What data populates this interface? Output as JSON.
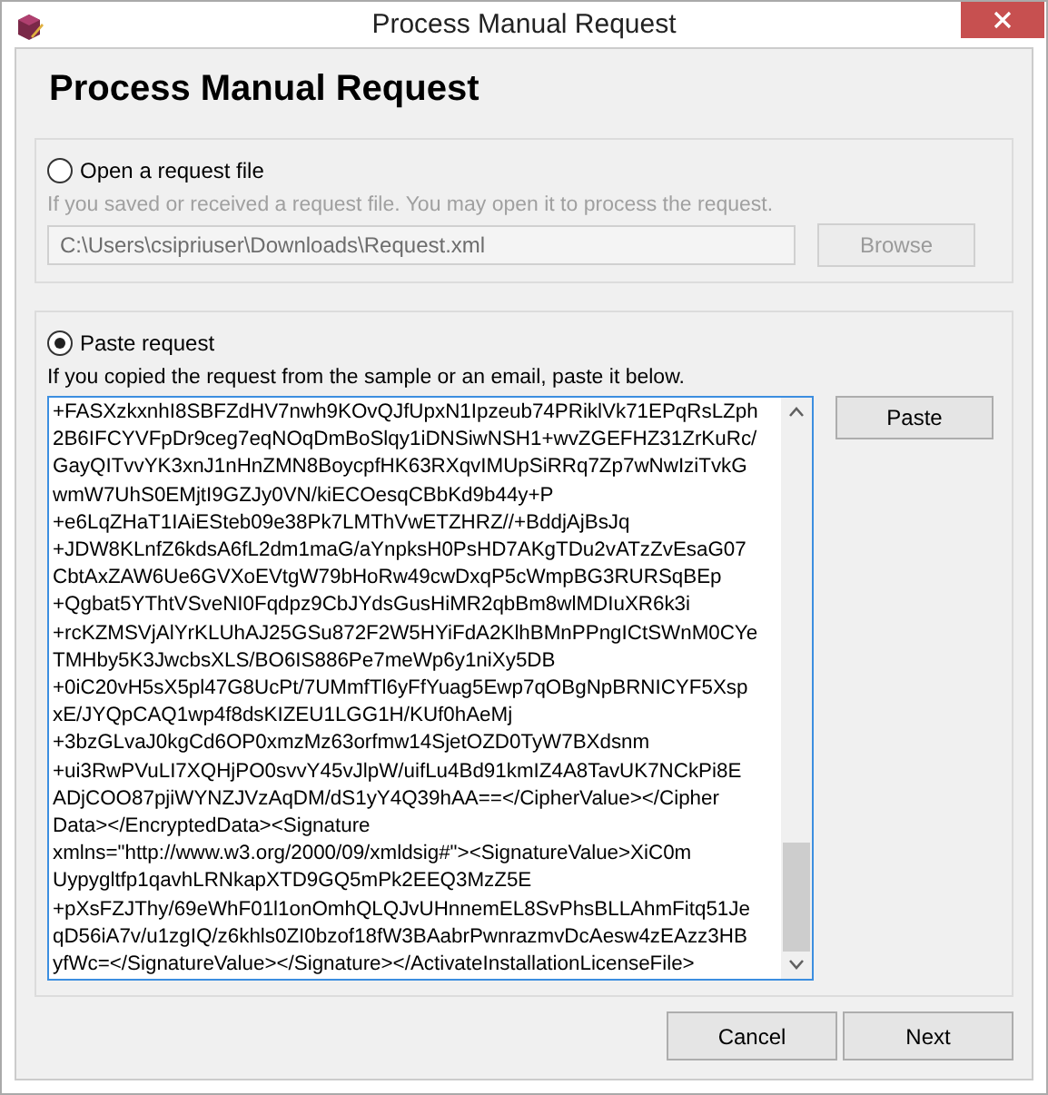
{
  "window": {
    "title": "Process Manual Request"
  },
  "heading": "Process Manual Request",
  "options": [
    {
      "label": "Open a request file",
      "selected": false,
      "disabled": true,
      "hint": "If you saved or received a request file. You may open it to process the request.",
      "path": "C:\\Users\\csipriuser\\Downloads\\Request.xml",
      "button": "Browse"
    },
    {
      "label": "Paste request",
      "selected": true,
      "disabled": false,
      "hint": "If you copied the request from the sample or an email, paste it below.",
      "button": "Paste",
      "lines": [
        "+FASXzkxnhI8SBFZdHV7nwh9KOvQJfUpxN1Ipzeub74PRiklVk71EPqRsLZph",
        "2B6IFCYVFpDr9ceg7eqNOqDmBoSlqy1iDNSiwNSH1+wvZGEFHZ31ZrKuRc/",
        "GayQITvvYK3xnJ1nHnZMN8BoycpfHK63RXqvIMUpSiRRq7Zp7wNwIziTvkG",
        "wmW7UhS0EMjtI9GZJy0VN/kiECOesqCBbKd9b44y+P",
        "+e6LqZHaT1IAiESteb09e38Pk7LMThVwETZHRZ//+BddjAjBsJq",
        "+JDW8KLnfZ6kdsA6fL2dm1maG/aYnpksH0PsHD7AKgTDu2vATzZvEsaG07",
        "CbtAxZAW6Ue6GVXoEVtgW79bHoRw49cwDxqP5cWmpBG3RURSqBEp",
        "+Qgbat5YThtVSveNI0Fqdpz9CbJYdsGusHiMR2qbBm8wlMDIuXR6k3i",
        "+rcKZMSVjAlYrKLUhAJ25GSu872F2W5HYiFdA2KlhBMnPPngICtSWnM0CYe",
        "TMHby5K3JwcbsXLS/BO6IS886Pe7meWp6y1niXy5DB",
        "+0iC20vH5sX5pl47G8UcPt/7UMmfTl6yFfYuag5Ewp7qOBgNpBRNICYF5Xsp",
        "xE/JYQpCAQ1wp4f8dsKIZEU1LGG1H/KUf0hAeMj",
        "+3bzGLvaJ0kgCd6OP0xmzMz63orfmw14SjetOZD0TyW7BXdsnm",
        "+ui3RwPVuLI7XQHjPO0svvY45vJlpW/uifLu4Bd91kmIZ4A8TavUK7NCkPi8E",
        "ADjCOO87pjiWYNZJVzAqDM/dS1yY4Q39hAA==</CipherValue></Cipher",
        "Data></EncryptedData><Signature",
        "xmlns=\"http://www.w3.org/2000/09/xmldsig#\"><SignatureValue>XiC0m",
        "Uypygltfp1qavhLRNkapXTD9GQ5mPk2EEQ3MzZ5E",
        "+pXsFZJThy/69eWhF01l1onOmhQLQJvUHnnemEL8SvPhsBLLAhmFitq51Je",
        "qD56iA7v/u1zgIQ/z6khls0ZI0bzof18fW3BAabrPwnrazmvDcAesw4zEAzz3HB",
        "yfWc=</SignatureValue></Signature></ActivateInstallationLicenseFile>"
      ]
    }
  ],
  "buttons": [
    {
      "label": "Cancel"
    },
    {
      "label": "Next"
    }
  ]
}
